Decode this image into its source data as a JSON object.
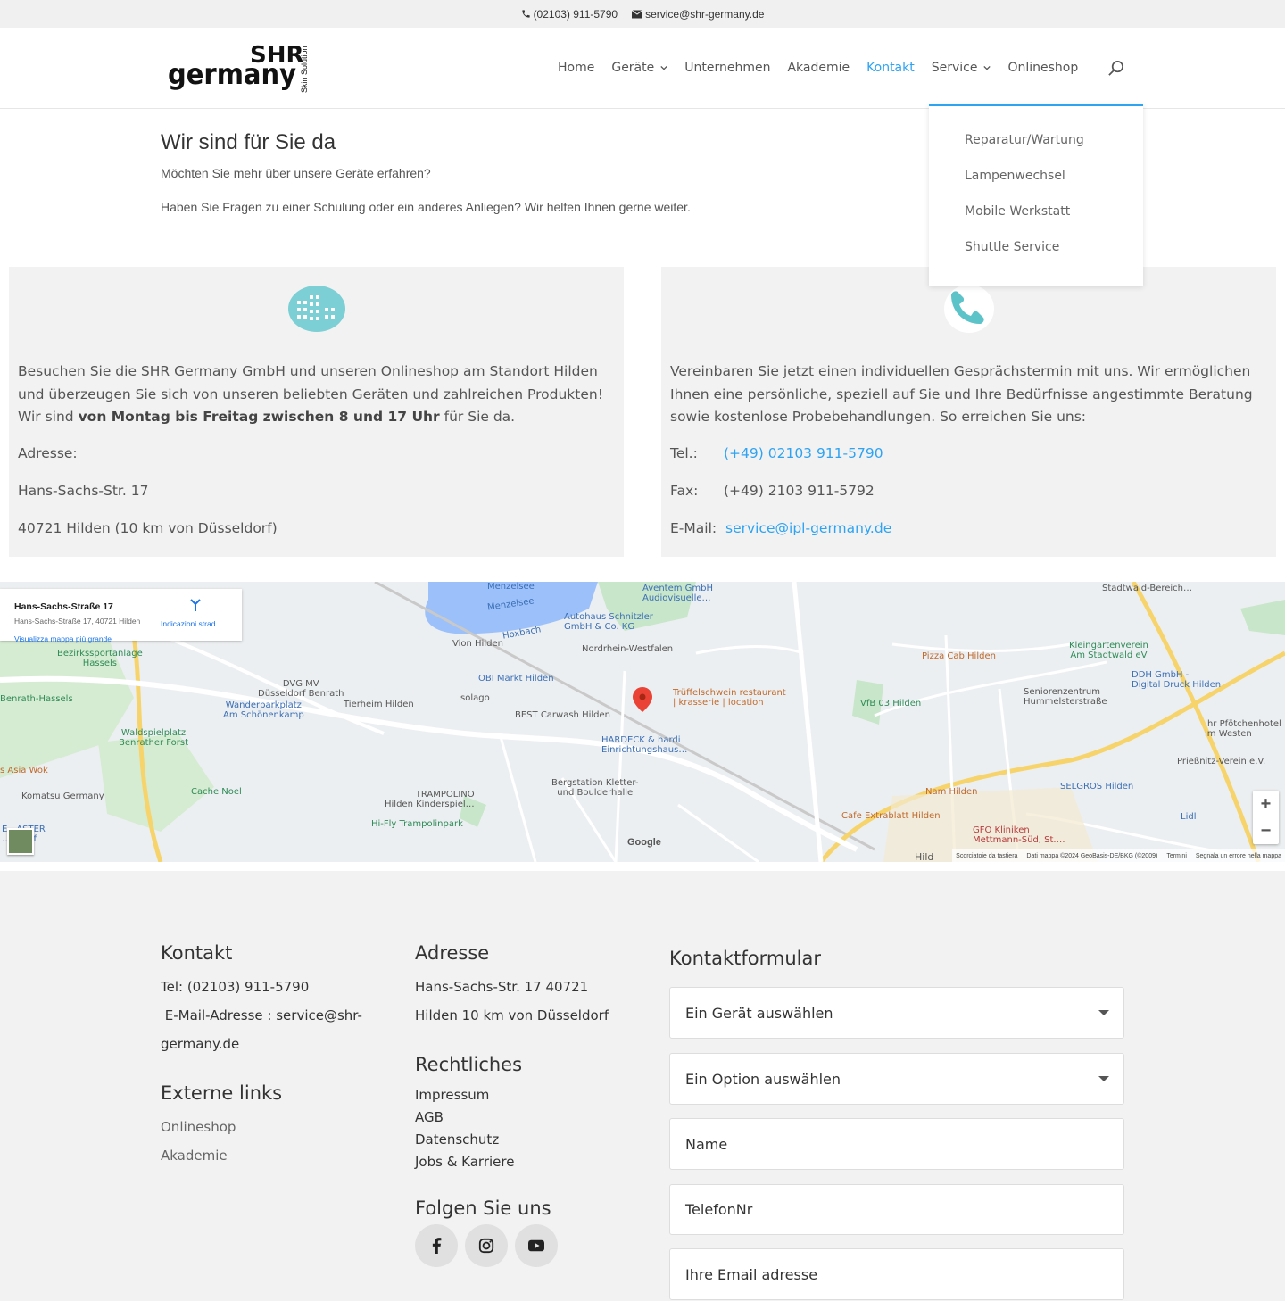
{
  "topbar": {
    "phone": "(02103) 911-5790",
    "email": "service@shr-germany.de"
  },
  "logo": {
    "line1": "SHR",
    "line2": "germany",
    "side": "Skin Solution"
  },
  "nav": {
    "items": [
      "Home",
      "Geräte",
      "Unternehmen",
      "Akademie",
      "Kontakt",
      "Service",
      "Onlineshop"
    ],
    "active": "Kontakt",
    "accent": "#2ea3f2"
  },
  "dropdown": {
    "items": [
      "Reparatur/Wartung",
      "Lampenwechsel",
      "Mobile Werkstatt",
      "Shuttle Service"
    ]
  },
  "intro": {
    "title": "Wir sind für Sie da",
    "line1": "Möchten Sie mehr über unsere Geräte erfahren?",
    "line2": "Haben Sie Fragen zu einer Schulung oder ein anderes Anliegen? Wir helfen Ihnen gerne weiter."
  },
  "card_left": {
    "icon": "building-icon",
    "text_a": "Besuchen Sie die SHR Germany GmbH und unseren Onlineshop am Standort Hilden und überzeugen Sie sich von unseren beliebten Geräten und zahlreichen Produkten! Wir sind ",
    "text_b": "von Montag bis Freitag zwischen 8 und 17 Uhr",
    "text_c": " für Sie da.",
    "address_label": "Adresse:",
    "street": "Hans-Sachs-Str. 17",
    "city": "40721 Hilden (10 km von Düsseldorf)"
  },
  "card_right": {
    "icon": "phone-icon",
    "text": "Vereinbaren Sie jetzt einen individuellen Gesprächstermin mit uns. Wir ermöglichen Ihnen eine persönliche, speziell auf Sie und Ihre Bedürfnisse angestimmte Beratung sowie kostenlose Probebehandlungen. So erreichen Sie uns:",
    "tel_label": "Tel.:",
    "tel": "(+49) 02103 911-5790",
    "fax_label": "Fax:",
    "fax": "(+49) 2103 911-5792",
    "mail_label": "E-Mail:",
    "mail": "service@ipl-germany.de"
  },
  "map": {
    "info_title": "Hans-Sachs-Straße 17",
    "info_address": "Hans-Sachs-Straße 17, 40721 Hilden",
    "info_directions": "Indicazioni strad…",
    "info_larger": "Visualizza mappa più grande",
    "zoom_in": "+",
    "zoom_out": "−",
    "google": "Google",
    "footer_shortcuts": "Scorciatoie da tastiera",
    "footer_data": "Dati mappa ©2024 GeoBasis-DE/BKG (©2009)",
    "footer_terms": "Termini",
    "footer_report": "Segnala un errore nella mappa",
    "pois": {
      "menzelsee": "Menzelsee",
      "menzelsee2": "Menzelsee",
      "aventem": "Aventem GmbH\nAudiovisuelle…",
      "autohaus": "Autohaus Schnitzler\nGmbH & Co. KG",
      "nrw": "Nordrhein-Westfalen",
      "vion": "Vion Hilden",
      "hoxbach": "Hoxbach",
      "obi": "OBI Markt Hilden",
      "solago": "solago",
      "carwash": "BEST Carwash Hilden",
      "trueffel": "Trüffelschwein restaurant\n| krasserie | location",
      "hardeck": "HARDECK & hardi\nEinrichtungshaus…",
      "bergstation": "Bergstation Kletter-\nund Boulderhalle",
      "trampolino": "TRAMPOLINO\nHilden Kinderspiel…",
      "hifly": "Hi-Fly Trampolinpark",
      "cache": "Cache Noel",
      "komatsu": "Komatsu Germany",
      "asiawok": "s Asia Wok",
      "waldspiel": "Waldspielplatz\nBenrather Forst",
      "wanderpark": "Wanderparkplatz\nAm Schönenkamp",
      "dvg": "DVG MV\nDüsseldorf Benrath",
      "tierheim": "Tierheim Hilden",
      "bezirks": "Bezirkssportanlage\nHassels",
      "benrath": "Benrath-Hassels",
      "pizza": "Pizza Cab Hilden",
      "vfb": "VfB 03 Hilden",
      "kleingarten": "Kleingartenverein\nAm Stadtwald eV",
      "ddh": "DDH GmbH -\nDigital Druck Hilden",
      "senioren": "Seniorenzentrum\nHummelsterstraße",
      "pfoetchen": "Ihr Pfötchenhotel\nim Westen",
      "priessnitz": "Prießnitz-Verein e.V.",
      "selgros": "SELGROS Hilden",
      "lidl": "Lidl",
      "nam": "Nam Hilden",
      "cafe": "Cafe Extrablatt Hilden",
      "gfo": "GFO Kliniken\nMettmann-Süd, St.…",
      "stadtwald": "Stadtwald-Bereich…",
      "hilden": "Hild",
      "easter": "E…ASTER\n…eldorf"
    }
  },
  "footer": {
    "kontakt_h": "Kontakt",
    "kontakt_tel": "Tel: (02103) 911-5790",
    "kontakt_mail_a": " E-Mail-Adresse : service@shr-",
    "kontakt_mail_b": "germany.de",
    "extern_h": "Externe links",
    "extern_links": [
      "Onlineshop",
      "Akademie"
    ],
    "adresse_h": "Adresse",
    "adresse_1": "Hans-Sachs-Str. 17 40721",
    "adresse_2": "Hilden 10 km von Düsseldorf",
    "recht_h": "Rechtliches",
    "recht_links": [
      "Impressum",
      "AGB",
      "Datenschutz",
      "Jobs & Karriere"
    ],
    "social_h": "Folgen Sie uns",
    "social": [
      "facebook-icon",
      "instagram-icon",
      "youtube-icon"
    ],
    "form_h": "Kontaktformular",
    "form": {
      "device": "Ein Gerät auswählen",
      "option": "Ein Option auswählen",
      "name": "Name",
      "tel": "TelefonNr",
      "email": "Ihre Email adresse"
    }
  }
}
